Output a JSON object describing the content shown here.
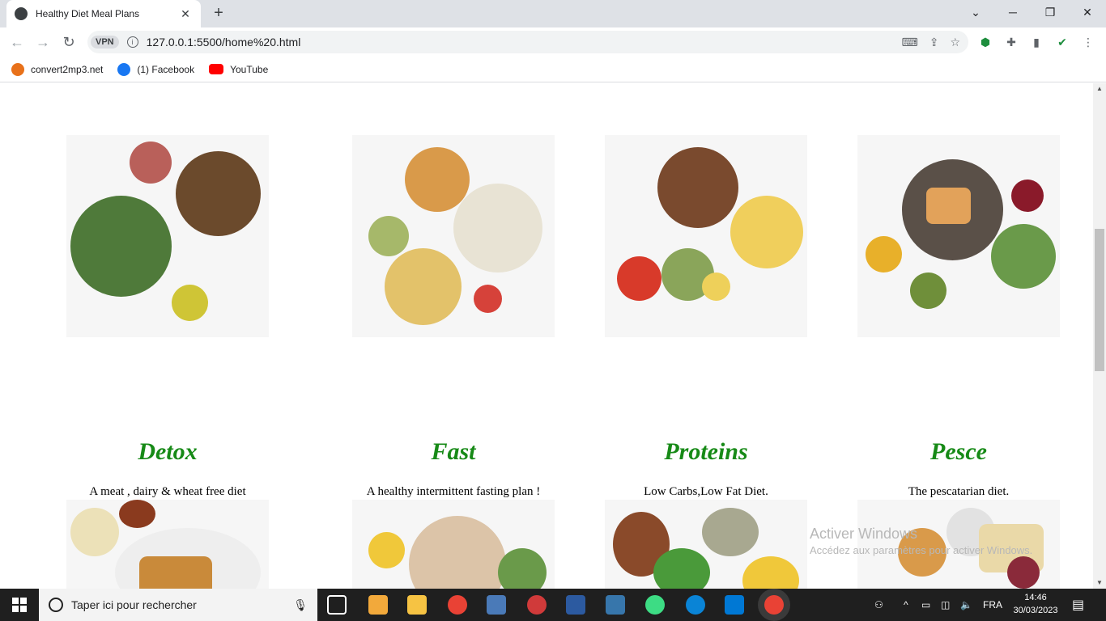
{
  "browser": {
    "tab_title": "Healthy Diet Meal Plans",
    "tab_close": "✕",
    "new_tab": "+",
    "vpn_label": "VPN",
    "url": "127.0.0.1:5500/home%20.html",
    "bookmarks": [
      {
        "label": "convert2mp3.net",
        "color": "#e8711a"
      },
      {
        "label": "(1) Facebook",
        "color": "#1877f2"
      },
      {
        "label": "YouTube",
        "color": "#ff0000"
      }
    ]
  },
  "cards": [
    {
      "title": "Detox",
      "desc": "A meat , dairy & wheat free diet"
    },
    {
      "title": "Fast",
      "desc": "A healthy intermittent fasting plan !"
    },
    {
      "title": "Proteins",
      "desc": "Low Carbs,Low Fat Diet."
    },
    {
      "title": "Pesce",
      "desc": "The pescatarian diet."
    }
  ],
  "colors": {
    "title_green": "#178a17"
  },
  "watermark": {
    "line1": "Activer Windows",
    "line2": "Accédez aux paramètres pour activer Windows."
  },
  "taskbar": {
    "search_placeholder": "Taper ici pour rechercher",
    "language": "FRA",
    "time": "14:46",
    "date": "30/03/2023"
  }
}
